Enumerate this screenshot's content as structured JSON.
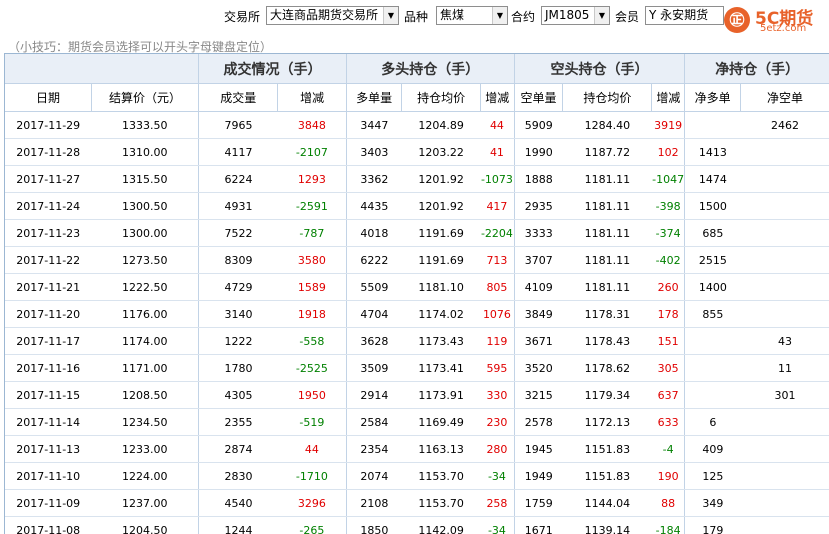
{
  "filters": {
    "exchange_label": "交易所",
    "exchange_value": "大连商品期货交易所",
    "variety_label": "品种",
    "variety_value": "焦煤",
    "contract_label": "合约",
    "contract_value": "JM1805",
    "member_label": "会员",
    "member_value": "Y 永安期货"
  },
  "logo": {
    "glyph": "㊣",
    "name": "5C期货",
    "site": "5etz.com"
  },
  "tip": "（小技巧：期货会员选择可以开头字母键盘定位）",
  "table": {
    "groups": [
      "成交情况（手）",
      "多头持仓（手）",
      "空头持仓（手）",
      "净持仓（手）"
    ],
    "headers": [
      "日期",
      "结算价（元）",
      "成交量",
      "增减",
      "多单量",
      "持仓均价",
      "增减",
      "空单量",
      "持仓均价",
      "增减",
      "净多单",
      "净空单"
    ],
    "rows": [
      [
        "2017-11-29",
        "1333.50",
        "7965",
        "3848",
        "3447",
        "1204.89",
        "44",
        "5909",
        "1284.40",
        "3919",
        "",
        "2462"
      ],
      [
        "2017-11-28",
        "1310.00",
        "4117",
        "-2107",
        "3403",
        "1203.22",
        "41",
        "1990",
        "1187.72",
        "102",
        "1413",
        ""
      ],
      [
        "2017-11-27",
        "1315.50",
        "6224",
        "1293",
        "3362",
        "1201.92",
        "-1073",
        "1888",
        "1181.11",
        "-1047",
        "1474",
        ""
      ],
      [
        "2017-11-24",
        "1300.50",
        "4931",
        "-2591",
        "4435",
        "1201.92",
        "417",
        "2935",
        "1181.11",
        "-398",
        "1500",
        ""
      ],
      [
        "2017-11-23",
        "1300.00",
        "7522",
        "-787",
        "4018",
        "1191.69",
        "-2204",
        "3333",
        "1181.11",
        "-374",
        "685",
        ""
      ],
      [
        "2017-11-22",
        "1273.50",
        "8309",
        "3580",
        "6222",
        "1191.69",
        "713",
        "3707",
        "1181.11",
        "-402",
        "2515",
        ""
      ],
      [
        "2017-11-21",
        "1222.50",
        "4729",
        "1589",
        "5509",
        "1181.10",
        "805",
        "4109",
        "1181.11",
        "260",
        "1400",
        ""
      ],
      [
        "2017-11-20",
        "1176.00",
        "3140",
        "1918",
        "4704",
        "1174.02",
        "1076",
        "3849",
        "1178.31",
        "178",
        "855",
        ""
      ],
      [
        "2017-11-17",
        "1174.00",
        "1222",
        "-558",
        "3628",
        "1173.43",
        "119",
        "3671",
        "1178.43",
        "151",
        "",
        "43"
      ],
      [
        "2017-11-16",
        "1171.00",
        "1780",
        "-2525",
        "3509",
        "1173.41",
        "595",
        "3520",
        "1178.62",
        "305",
        "",
        "11"
      ],
      [
        "2017-11-15",
        "1208.50",
        "4305",
        "1950",
        "2914",
        "1173.91",
        "330",
        "3215",
        "1179.34",
        "637",
        "",
        "301"
      ],
      [
        "2017-11-14",
        "1234.50",
        "2355",
        "-519",
        "2584",
        "1169.49",
        "230",
        "2578",
        "1172.13",
        "633",
        "6",
        ""
      ],
      [
        "2017-11-13",
        "1233.00",
        "2874",
        "44",
        "2354",
        "1163.13",
        "280",
        "1945",
        "1151.83",
        "-4",
        "409",
        ""
      ],
      [
        "2017-11-10",
        "1224.00",
        "2830",
        "-1710",
        "2074",
        "1153.70",
        "-34",
        "1949",
        "1151.83",
        "190",
        "125",
        ""
      ],
      [
        "2017-11-09",
        "1237.00",
        "4540",
        "3296",
        "2108",
        "1153.70",
        "258",
        "1759",
        "1144.04",
        "88",
        "349",
        ""
      ],
      [
        "2017-11-08",
        "1204.50",
        "1244",
        "-265",
        "1850",
        "1142.09",
        "-34",
        "1671",
        "1139.14",
        "-184",
        "179",
        ""
      ]
    ]
  },
  "colors": {
    "increase": "#e00000",
    "decrease": "#008000",
    "header_bg": "#e9eff7",
    "brand": "#e8622a"
  }
}
